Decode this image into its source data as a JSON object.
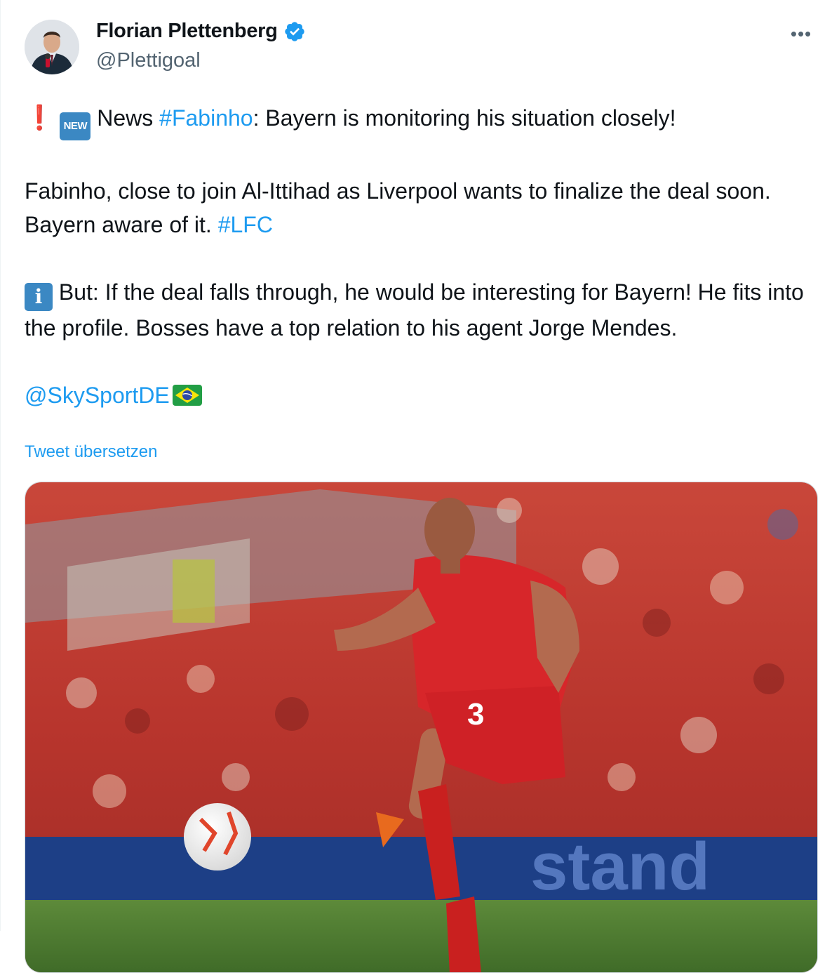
{
  "author": {
    "display_name": "Florian Plettenberg",
    "handle": "@Plettigoal",
    "verified": true
  },
  "tweet": {
    "line1_prefix": "News ",
    "line1_hashtag": "#Fabinho",
    "line1_rest": ": Bayern is monitoring his situation closely!",
    "para2_text": "Fabinho, close to join Al-Ittihad as Liverpool wants to finalize the deal soon. Bayern aware of it. ",
    "para2_hashtag": "#LFC",
    "para3_text": " But: If the deal falls through, he would be interesting for Bayern! He fits into the profile. Bosses have a top relation to his agent Jorge Mendes.",
    "mention": "@SkySportDE",
    "new_badge": "NEW",
    "info_badge": "i",
    "exclamation": "❗"
  },
  "translate_label": "Tweet übersetzen",
  "more_label": "•••",
  "colors": {
    "link": "#1d9bf0",
    "secondary": "#536471",
    "verified": "#1d9bf0",
    "badge": "#3b88c3"
  },
  "icons": {
    "verified": "verified-badge-icon",
    "more": "more-options-icon",
    "flag": "brazil-flag-icon"
  }
}
